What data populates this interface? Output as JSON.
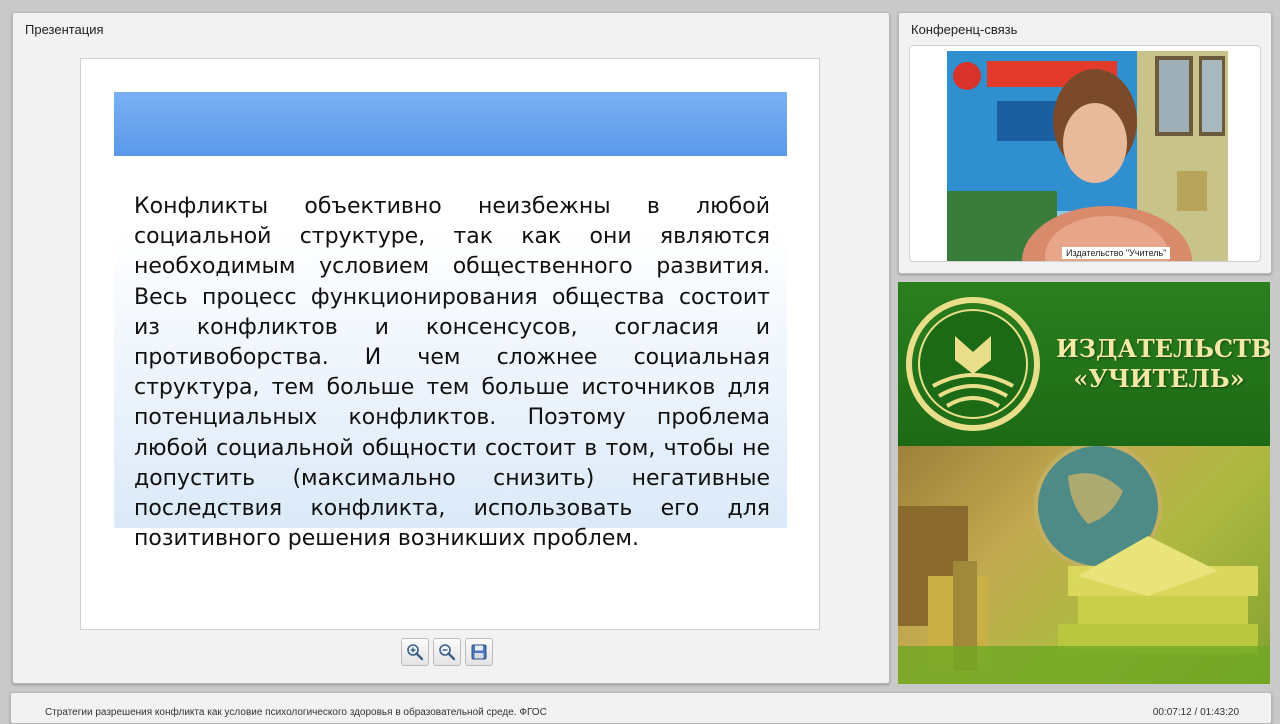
{
  "presentation": {
    "title": "Презентация",
    "slide_text": "Конфликты объективно неизбежны в любой социальной структуре, так как они являются необходимым условием общественного развития. Весь процесс функционирования общества состоит из конфликтов и консенсусов, согласия и противоборства. И чем сложнее социальная структура, тем больше тем больше источников для потенциальных конфликтов. Поэтому проблема любой социальной общности состоит в том, чтобы не допустить (максимально снизить) негативные последствия конфликта, использовать его для позитивного решения возникших проблем.",
    "toolbar": {
      "icons": [
        "zoom-in-icon",
        "zoom-out-icon",
        "save-icon"
      ]
    }
  },
  "conference": {
    "title": "Конференц-связь",
    "caption": "Издательство \"Учитель\""
  },
  "banner": {
    "line1": "ИЗДАТЕЛЬСТВО",
    "line2": "«УЧИТЕЛЬ»"
  },
  "statusbar": {
    "course_title": "Стратегии разрешения конфликта как условие психологического здоровья в образовательной среде. ФГОС",
    "timecode": "00:07:12 / 01:43:20"
  },
  "colors": {
    "slide_band": "#5a98ea",
    "banner_green": "#1d6a16",
    "banner_text": "#f4e9a4"
  }
}
